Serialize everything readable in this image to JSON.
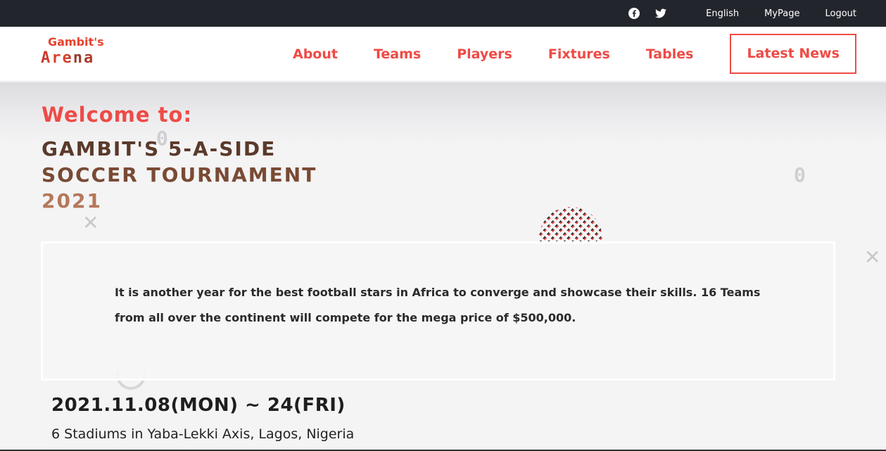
{
  "topbar": {
    "social": [
      "facebook-icon",
      "twitter-icon"
    ],
    "links": {
      "language": "English",
      "mypage": "MyPage",
      "logout": "Logout"
    }
  },
  "header": {
    "logo_line1": "Gambit's",
    "logo_line2": "Arena",
    "nav": {
      "about": "About",
      "teams": "Teams",
      "players": "Players",
      "fixtures": "Fixtures",
      "tables": "Tables",
      "news": "Latest News"
    }
  },
  "hero": {
    "welcome": "Welcome to:",
    "title_line1": "GAMBIT'S 5-A-SIDE",
    "title_line2": "SOCCER TOURNAMENT",
    "title_line3": "2021",
    "description": "It is another year for the best football stars in Africa to converge and showcase their skills. 16 Teams from all over the continent will compete for the mega price of $500,000.",
    "date": "2021.11.08(MON) ~ 24(FRI)",
    "venue": "6 Stadiums in Yaba-Lekki Axis, Lagos, Nigeria"
  },
  "colors": {
    "accent": "#ee4b46",
    "topbar": "#23252d"
  }
}
